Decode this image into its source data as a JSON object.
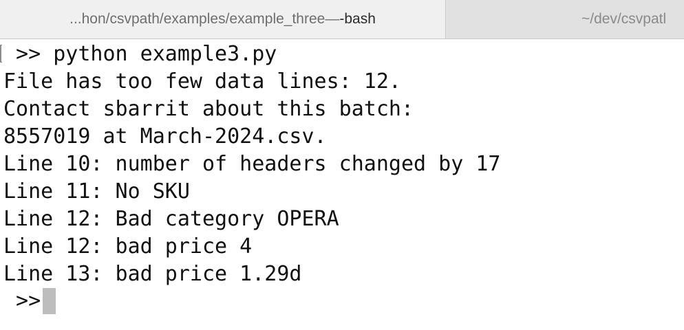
{
  "tabs": [
    {
      "path": "...hon/csvpath/examples/example_three",
      "separator": " — ",
      "process": "-bash",
      "active": true
    },
    {
      "path": "~/dev/csvpatl",
      "active": false
    }
  ],
  "terminal": {
    "lines": [
      " >> python example3.py",
      "File has too few data lines: 12.",
      "Contact sbarrit about this batch:",
      "8557019 at March-2024.csv.",
      "Line 10: number of headers changed by 17",
      "Line 11: No SKU",
      "Line 12: Bad category OPERA",
      "Line 12: bad price 4",
      "Line 13: bad price 1.29d"
    ],
    "prompt": " >>"
  },
  "colors": {
    "tabbar_bg": "#e4e3e3",
    "active_tab_bg": "#f1f0f0",
    "terminal_bg": "#ffffff",
    "text": "#111111",
    "cursor": "#bdbdbd"
  },
  "icons": {
    "cursor": "block-cursor"
  }
}
